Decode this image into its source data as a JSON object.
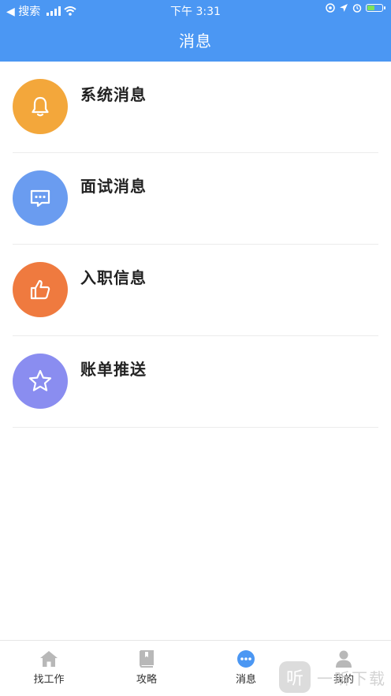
{
  "status_bar": {
    "back_label": "◀ 搜索",
    "time": "下午 3:31"
  },
  "header": {
    "title": "消息"
  },
  "messages": [
    {
      "label": "系统消息",
      "icon": "bell-icon",
      "color": "#f3a73b"
    },
    {
      "label": "面试消息",
      "icon": "chat-icon",
      "color": "#6a9cf0"
    },
    {
      "label": "入职信息",
      "icon": "thumbs-up-icon",
      "color": "#ef7a3f"
    },
    {
      "label": "账单推送",
      "icon": "star-icon",
      "color": "#8a8df0"
    }
  ],
  "tabs": [
    {
      "label": "找工作",
      "icon": "home-icon"
    },
    {
      "label": "攻略",
      "icon": "book-icon"
    },
    {
      "label": "消息",
      "icon": "message-icon",
      "active": true
    },
    {
      "label": "我的",
      "icon": "profile-icon"
    }
  ],
  "colors": {
    "primary": "#4b97f3",
    "tab_icon": "#b8b8b8",
    "tab_active": "#4b97f3"
  },
  "watermark": {
    "logo": "听",
    "text": "一听下载"
  }
}
